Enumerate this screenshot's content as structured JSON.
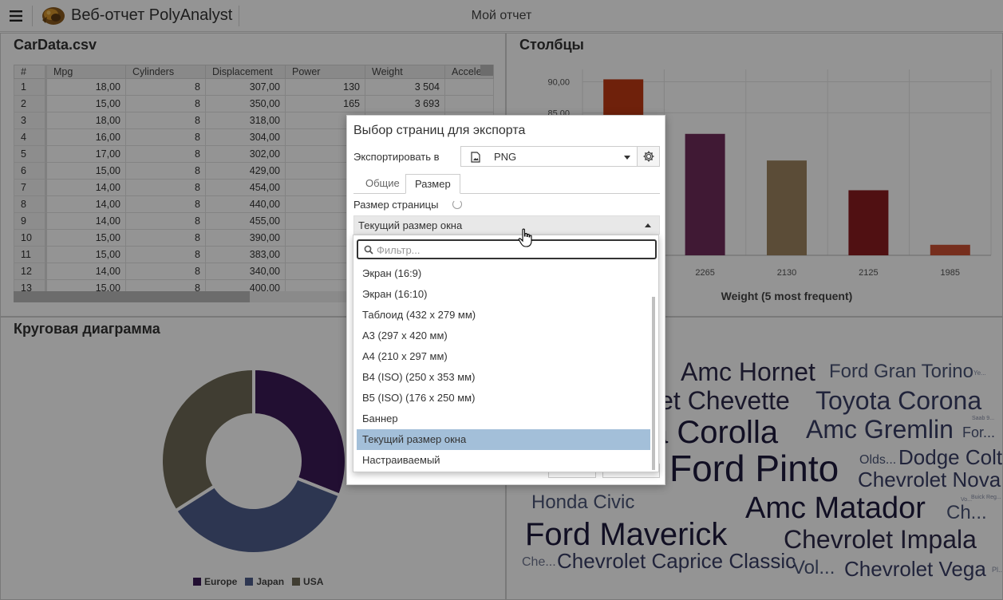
{
  "app": {
    "title": "Веб-отчет PolyAnalyst",
    "report_title": "Мой отчет"
  },
  "table_panel": {
    "title": "CarData.csv",
    "columns": [
      "#",
      "Mpg",
      "Cylinders",
      "Displacement",
      "Power",
      "Weight",
      "Accele"
    ],
    "rows": [
      [
        "1",
        "18,00",
        "8",
        "307,00",
        "130",
        "3 504",
        ""
      ],
      [
        "2",
        "15,00",
        "8",
        "350,00",
        "165",
        "3 693",
        ""
      ],
      [
        "3",
        "18,00",
        "8",
        "318,00",
        "1",
        ""
      ],
      [
        "4",
        "16,00",
        "8",
        "304,00",
        "1",
        ""
      ],
      [
        "5",
        "17,00",
        "8",
        "302,00",
        "1",
        ""
      ],
      [
        "6",
        "15,00",
        "8",
        "429,00",
        "1",
        ""
      ],
      [
        "7",
        "14,00",
        "8",
        "454,00",
        "2",
        ""
      ],
      [
        "8",
        "14,00",
        "8",
        "440,00",
        "2",
        ""
      ],
      [
        "9",
        "14,00",
        "8",
        "455,00",
        "2",
        ""
      ],
      [
        "10",
        "15,00",
        "8",
        "390,00",
        "1",
        ""
      ],
      [
        "11",
        "15,00",
        "8",
        "383,00",
        "1",
        ""
      ],
      [
        "12",
        "14,00",
        "8",
        "340,00",
        "1",
        ""
      ],
      [
        "13",
        "15,00",
        "8",
        "400,00",
        "1",
        ""
      ]
    ]
  },
  "bar_panel": {
    "title": "Столбцы"
  },
  "chart_data": {
    "type": "bar",
    "categories": [
      "",
      "2265",
      "2130",
      "2125",
      "1985"
    ],
    "values": [
      90.4,
      81.6,
      77.3,
      72.5,
      63.7
    ],
    "ylim": [
      62,
      92
    ],
    "ytick_labels": [
      "90,00",
      "85,00"
    ],
    "yticks": [
      90,
      85
    ],
    "xlabel": "Weight (5 most frequent)",
    "colors": [
      "#bf3a13",
      "#6e2c5a",
      "#9e8460",
      "#8a1c1f",
      "#cc5033"
    ]
  },
  "pie_panel": {
    "title": "Круговая диаграмма",
    "legend": [
      {
        "label": "Europe",
        "color": "#3b1b57",
        "share": 0.31
      },
      {
        "label": "Japan",
        "color": "#4f5e8c",
        "share": 0.35
      },
      {
        "label": "USA",
        "color": "#6f6a56",
        "share": 0.34
      }
    ]
  },
  "word_cloud": {
    "words": [
      {
        "text": "4",
        "size": 32,
        "color": "#2d2a4a"
      },
      {
        "text": "Amc Hornet",
        "size": 32,
        "color": "#2d2a4a"
      },
      {
        "text": "Ford Gran Torino",
        "size": 24,
        "color": "#4a5577"
      },
      {
        "text": "Ye...",
        "size": 8,
        "color": "#8890a8"
      },
      {
        "text": "let Chevette",
        "size": 32,
        "color": "#2d2a4a"
      },
      {
        "text": "Toyota Corona",
        "size": 32,
        "color": "#3a3f66"
      },
      {
        "text": "a Corolla",
        "size": 40,
        "color": "#1e1a3d"
      },
      {
        "text": "Amc Gremlin",
        "size": 32,
        "color": "#3a3f66"
      },
      {
        "text": "Saab 9...",
        "size": 7,
        "color": "#8890a8"
      },
      {
        "text": "For...",
        "size": 18,
        "color": "#4a5577"
      },
      {
        "text": "Ford Pinto",
        "size": 46,
        "color": "#1e1a3d"
      },
      {
        "text": "Olds...",
        "size": 16,
        "color": "#4a5577"
      },
      {
        "text": "Dodge Colt",
        "size": 26,
        "color": "#3a3f66"
      },
      {
        "text": "Chevrolet Nova",
        "size": 26,
        "color": "#3a3f66"
      },
      {
        "text": "Honda Civic",
        "size": 24,
        "color": "#4a5577"
      },
      {
        "text": "Amc Matador",
        "size": 38,
        "color": "#1e1a3d"
      },
      {
        "text": "Vo...",
        "size": 7,
        "color": "#8890a8"
      },
      {
        "text": "Buick Reg...",
        "size": 7,
        "color": "#8890a8"
      },
      {
        "text": "Ch...",
        "size": 24,
        "color": "#4a5577"
      },
      {
        "text": "Ford Maverick",
        "size": 40,
        "color": "#1e1a3d"
      },
      {
        "text": "Chevrolet Impala",
        "size": 32,
        "color": "#2d2a4a"
      },
      {
        "text": "Che...",
        "size": 16,
        "color": "#6f7590"
      },
      {
        "text": "Chevrolet Caprice Classic",
        "size": 26,
        "color": "#3a3f66"
      },
      {
        "text": "Vol...",
        "size": 24,
        "color": "#4a5577"
      },
      {
        "text": "Chevrolet Vega",
        "size": 26,
        "color": "#3a3f66"
      },
      {
        "text": "Pl...",
        "size": 9,
        "color": "#8890a8"
      }
    ]
  },
  "dialog": {
    "title": "Выбор страниц для экспорта",
    "export_label": "Экспортировать в",
    "format_value": "PNG",
    "tabs": [
      "Общие",
      "Размер"
    ],
    "active_tab": "Размер",
    "page_size_label": "Размер страницы",
    "page_size_value": "Текущий размер окна",
    "filter_placeholder": "Фильтр...",
    "options": [
      "Экран (16:9)",
      "Экран (16:10)",
      "Таблоид (432 x 279 мм)",
      "A3 (297 x 420 мм)",
      "A4 (210 x 297 мм)",
      "B4 (ISO) (250 x 353 мм)",
      "B5 (ISO) (176 x 250 мм)",
      "Баннер",
      "Текущий размер окна",
      "Настраиваемый"
    ],
    "selected_option": "Текущий размер окна"
  }
}
